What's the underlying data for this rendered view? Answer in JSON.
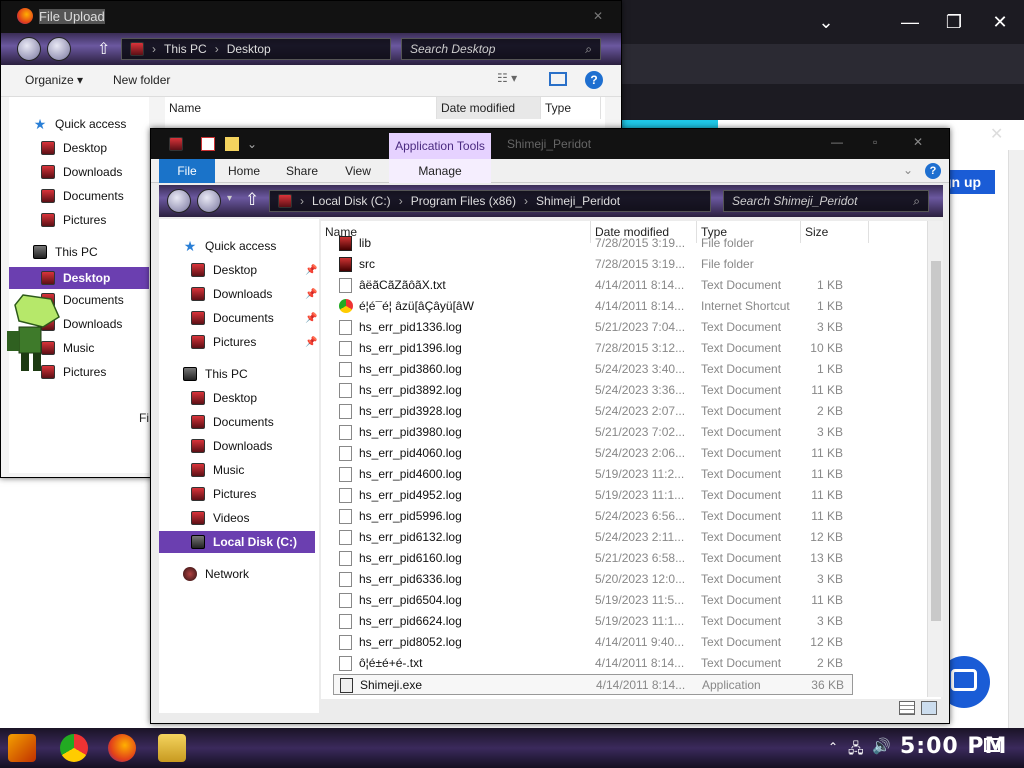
{
  "browser": {
    "signup_label": "gn up",
    "colors": {
      "accent": "#1a5cd6",
      "cyan": "#1fc8e8"
    }
  },
  "upload_window": {
    "title": "File Upload",
    "breadcrumb": [
      "This PC",
      "Desktop"
    ],
    "search_placeholder": "Search Desktop",
    "organize_label": "Organize",
    "new_folder_label": "New folder",
    "columns": {
      "name": "Name",
      "date": "Date modified",
      "type": "Type"
    },
    "sidebar": {
      "quick_access": "Quick access",
      "items": [
        "Desktop",
        "Downloads",
        "Documents",
        "Pictures"
      ],
      "this_pc": "This PC",
      "pc_items": [
        "Desktop",
        "Documents",
        "Downloads",
        "Music",
        "Pictures"
      ]
    },
    "filename_label": "Fi"
  },
  "explorer": {
    "title": "Shimeji_Peridot",
    "app_tools_label": "Application Tools",
    "ribbon": {
      "file": "File",
      "home": "Home",
      "share": "Share",
      "view": "View",
      "manage": "Manage"
    },
    "breadcrumb": [
      "Local Disk (C:)",
      "Program Files (x86)",
      "Shimeji_Peridot"
    ],
    "search_placeholder": "Search Shimeji_Peridot",
    "columns": {
      "name": "Name",
      "date": "Date modified",
      "type": "Type",
      "size": "Size"
    },
    "sidebar": {
      "quick_access": "Quick access",
      "qa_items": [
        "Desktop",
        "Downloads",
        "Documents",
        "Pictures"
      ],
      "this_pc": "This PC",
      "pc_items": [
        "Desktop",
        "Documents",
        "Downloads",
        "Music",
        "Pictures",
        "Videos"
      ],
      "local_disk": "Local Disk (C:)",
      "network": "Network"
    },
    "files": [
      {
        "name": "lib",
        "date": "7/28/2015 3:19...",
        "type": "File folder",
        "size": "",
        "icon": "folder"
      },
      {
        "name": "src",
        "date": "7/28/2015 3:19...",
        "type": "File folder",
        "size": "",
        "icon": "folder"
      },
      {
        "name": "âëãCãZãôãX.txt",
        "date": "4/14/2011 8:14...",
        "type": "Text Document",
        "size": "1 KB",
        "icon": "text"
      },
      {
        "name": "é¦é¯é¦ âzü[âÇâyü[âW",
        "date": "4/14/2011 8:14...",
        "type": "Internet Shortcut",
        "size": "1 KB",
        "icon": "web"
      },
      {
        "name": "hs_err_pid1336.log",
        "date": "5/21/2023 7:04...",
        "type": "Text Document",
        "size": "3 KB",
        "icon": "text"
      },
      {
        "name": "hs_err_pid1396.log",
        "date": "7/28/2015 3:12...",
        "type": "Text Document",
        "size": "10 KB",
        "icon": "text"
      },
      {
        "name": "hs_err_pid3860.log",
        "date": "5/24/2023 3:40...",
        "type": "Text Document",
        "size": "1 KB",
        "icon": "text"
      },
      {
        "name": "hs_err_pid3892.log",
        "date": "5/24/2023 3:36...",
        "type": "Text Document",
        "size": "11 KB",
        "icon": "text"
      },
      {
        "name": "hs_err_pid3928.log",
        "date": "5/24/2023 2:07...",
        "type": "Text Document",
        "size": "2 KB",
        "icon": "text"
      },
      {
        "name": "hs_err_pid3980.log",
        "date": "5/21/2023 7:02...",
        "type": "Text Document",
        "size": "3 KB",
        "icon": "text"
      },
      {
        "name": "hs_err_pid4060.log",
        "date": "5/24/2023 2:06...",
        "type": "Text Document",
        "size": "11 KB",
        "icon": "text"
      },
      {
        "name": "hs_err_pid4600.log",
        "date": "5/19/2023 11:2...",
        "type": "Text Document",
        "size": "11 KB",
        "icon": "text"
      },
      {
        "name": "hs_err_pid4952.log",
        "date": "5/19/2023 11:1...",
        "type": "Text Document",
        "size": "11 KB",
        "icon": "text"
      },
      {
        "name": "hs_err_pid5996.log",
        "date": "5/24/2023 6:56...",
        "type": "Text Document",
        "size": "11 KB",
        "icon": "text"
      },
      {
        "name": "hs_err_pid6132.log",
        "date": "5/24/2023 2:11...",
        "type": "Text Document",
        "size": "12 KB",
        "icon": "text"
      },
      {
        "name": "hs_err_pid6160.log",
        "date": "5/21/2023 6:58...",
        "type": "Text Document",
        "size": "13 KB",
        "icon": "text"
      },
      {
        "name": "hs_err_pid6336.log",
        "date": "5/20/2023 12:0...",
        "type": "Text Document",
        "size": "3 KB",
        "icon": "text"
      },
      {
        "name": "hs_err_pid6504.log",
        "date": "5/19/2023 11:5...",
        "type": "Text Document",
        "size": "11 KB",
        "icon": "text"
      },
      {
        "name": "hs_err_pid6624.log",
        "date": "5/19/2023 11:1...",
        "type": "Text Document",
        "size": "3 KB",
        "icon": "text"
      },
      {
        "name": "hs_err_pid8052.log",
        "date": "4/14/2011 9:40...",
        "type": "Text Document",
        "size": "12 KB",
        "icon": "text"
      },
      {
        "name": "ô¦é±é+é-.txt",
        "date": "4/14/2011 8:14...",
        "type": "Text Document",
        "size": "2 KB",
        "icon": "text"
      },
      {
        "name": "Shimeji.exe",
        "date": "4/14/2011 8:14...",
        "type": "Application",
        "size": "36 KB",
        "icon": "exe"
      }
    ],
    "selected_file": "Shimeji.exe"
  },
  "taskbar": {
    "clock": "5:00 PM"
  }
}
